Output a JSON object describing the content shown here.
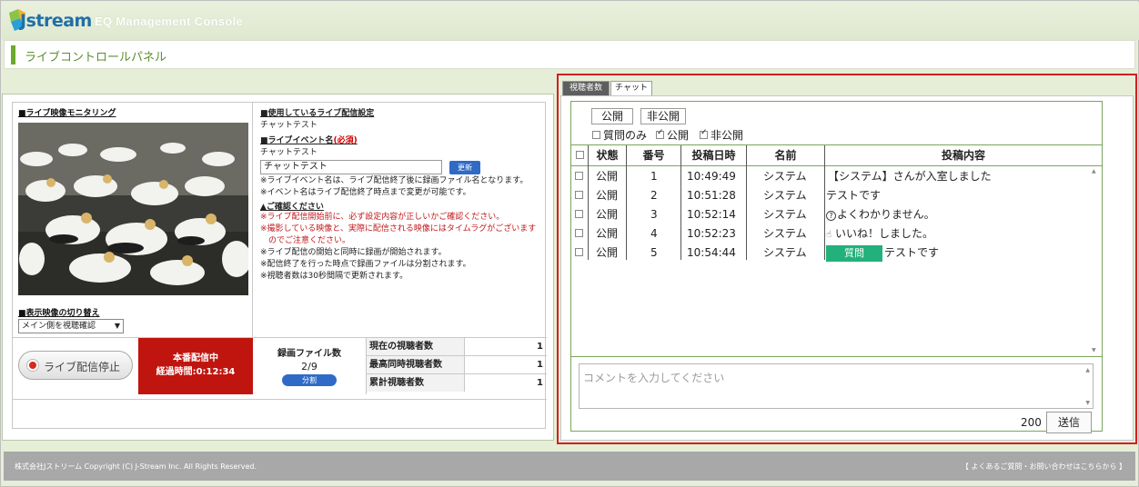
{
  "header": {
    "logo_text": "Jstream",
    "app_name": "EQ Management Console"
  },
  "page": {
    "title": "ライブコントロールパネル"
  },
  "monitor": {
    "title": "■ライブ映像モニタリング",
    "switch_title": "■表示映像の切り替え",
    "switch_selected": "メイン側を視聴確認"
  },
  "settings": {
    "config_title": "■使用しているライブ配信設定",
    "config_value": "チャットテスト",
    "event_title": "■ライブイベント名",
    "required": "(必須)",
    "event_current": "チャットテスト",
    "event_input": "チャットテスト",
    "update_label": "更新",
    "notes": [
      "※ライブイベント名は、ライブ配信終了後に録画ファイル名となります。",
      "※イベント名はライブ配信終了時点まで変更が可能です。"
    ],
    "caution_title": "▲ご確認ください",
    "warnings": [
      "※ライブ配信開始前に、必ず設定内容が正しいかご確認ください。",
      "※撮影している映像と、実際に配信される映像にはタイムラグがございます",
      "　のでご注意ください。"
    ],
    "info": [
      "※ライブ配信の開始と同時に録画が開始されます。",
      "※配信終了を行った時点で録画ファイルは分割されます。",
      "※視聴者数は30秒間隔で更新されます。"
    ]
  },
  "controls": {
    "stop_label": "ライブ配信停止",
    "live_status": "本番配信中",
    "elapsed": "経過時間:0:12:34",
    "rec_title": "録画ファイル数",
    "rec_count": "2/9",
    "split_label": "分割",
    "stats": [
      {
        "label": "現在の視聴者数",
        "value": "1"
      },
      {
        "label": "最高同時視聴者数",
        "value": "1"
      },
      {
        "label": "累計視聴者数",
        "value": "1"
      }
    ]
  },
  "chat": {
    "tabs": {
      "viewers": "視聴者数",
      "chat": "チャット"
    },
    "public_btn": "公開",
    "private_btn": "非公開",
    "filters": {
      "questions_only": "質問のみ",
      "public": "公開",
      "private": "非公開"
    },
    "columns": {
      "status": "状態",
      "number": "番号",
      "datetime": "投稿日時",
      "name": "名前",
      "content": "投稿内容"
    },
    "rows": [
      {
        "status": "公開",
        "number": "1",
        "time": "10:49:49",
        "name": "システム",
        "content": "【システム】さんが入室しました",
        "badge": ""
      },
      {
        "status": "公開",
        "number": "2",
        "time": "10:51:28",
        "name": "システム",
        "content": "テストです",
        "badge": ""
      },
      {
        "status": "公開",
        "number": "3",
        "time": "10:52:14",
        "name": "システム",
        "content": "よくわかりません。",
        "badge": "",
        "icon": "?"
      },
      {
        "status": "公開",
        "number": "4",
        "time": "10:52:23",
        "name": "システム",
        "content": "いいね！しました。",
        "badge": "",
        "icon": "👍"
      },
      {
        "status": "公開",
        "number": "5",
        "time": "10:54:44",
        "name": "システム",
        "content": "テストです",
        "badge": "質問"
      }
    ],
    "comment_placeholder": "コメントを入力してください",
    "char_count": "200",
    "send_label": "送信"
  },
  "footer": {
    "copyright": "株式会社Jストリーム  Copyright (C) J-Stream Inc. All Rights Reserved.",
    "faq": "【 よくあるご質問・お問い合わせはこちらから 】"
  }
}
